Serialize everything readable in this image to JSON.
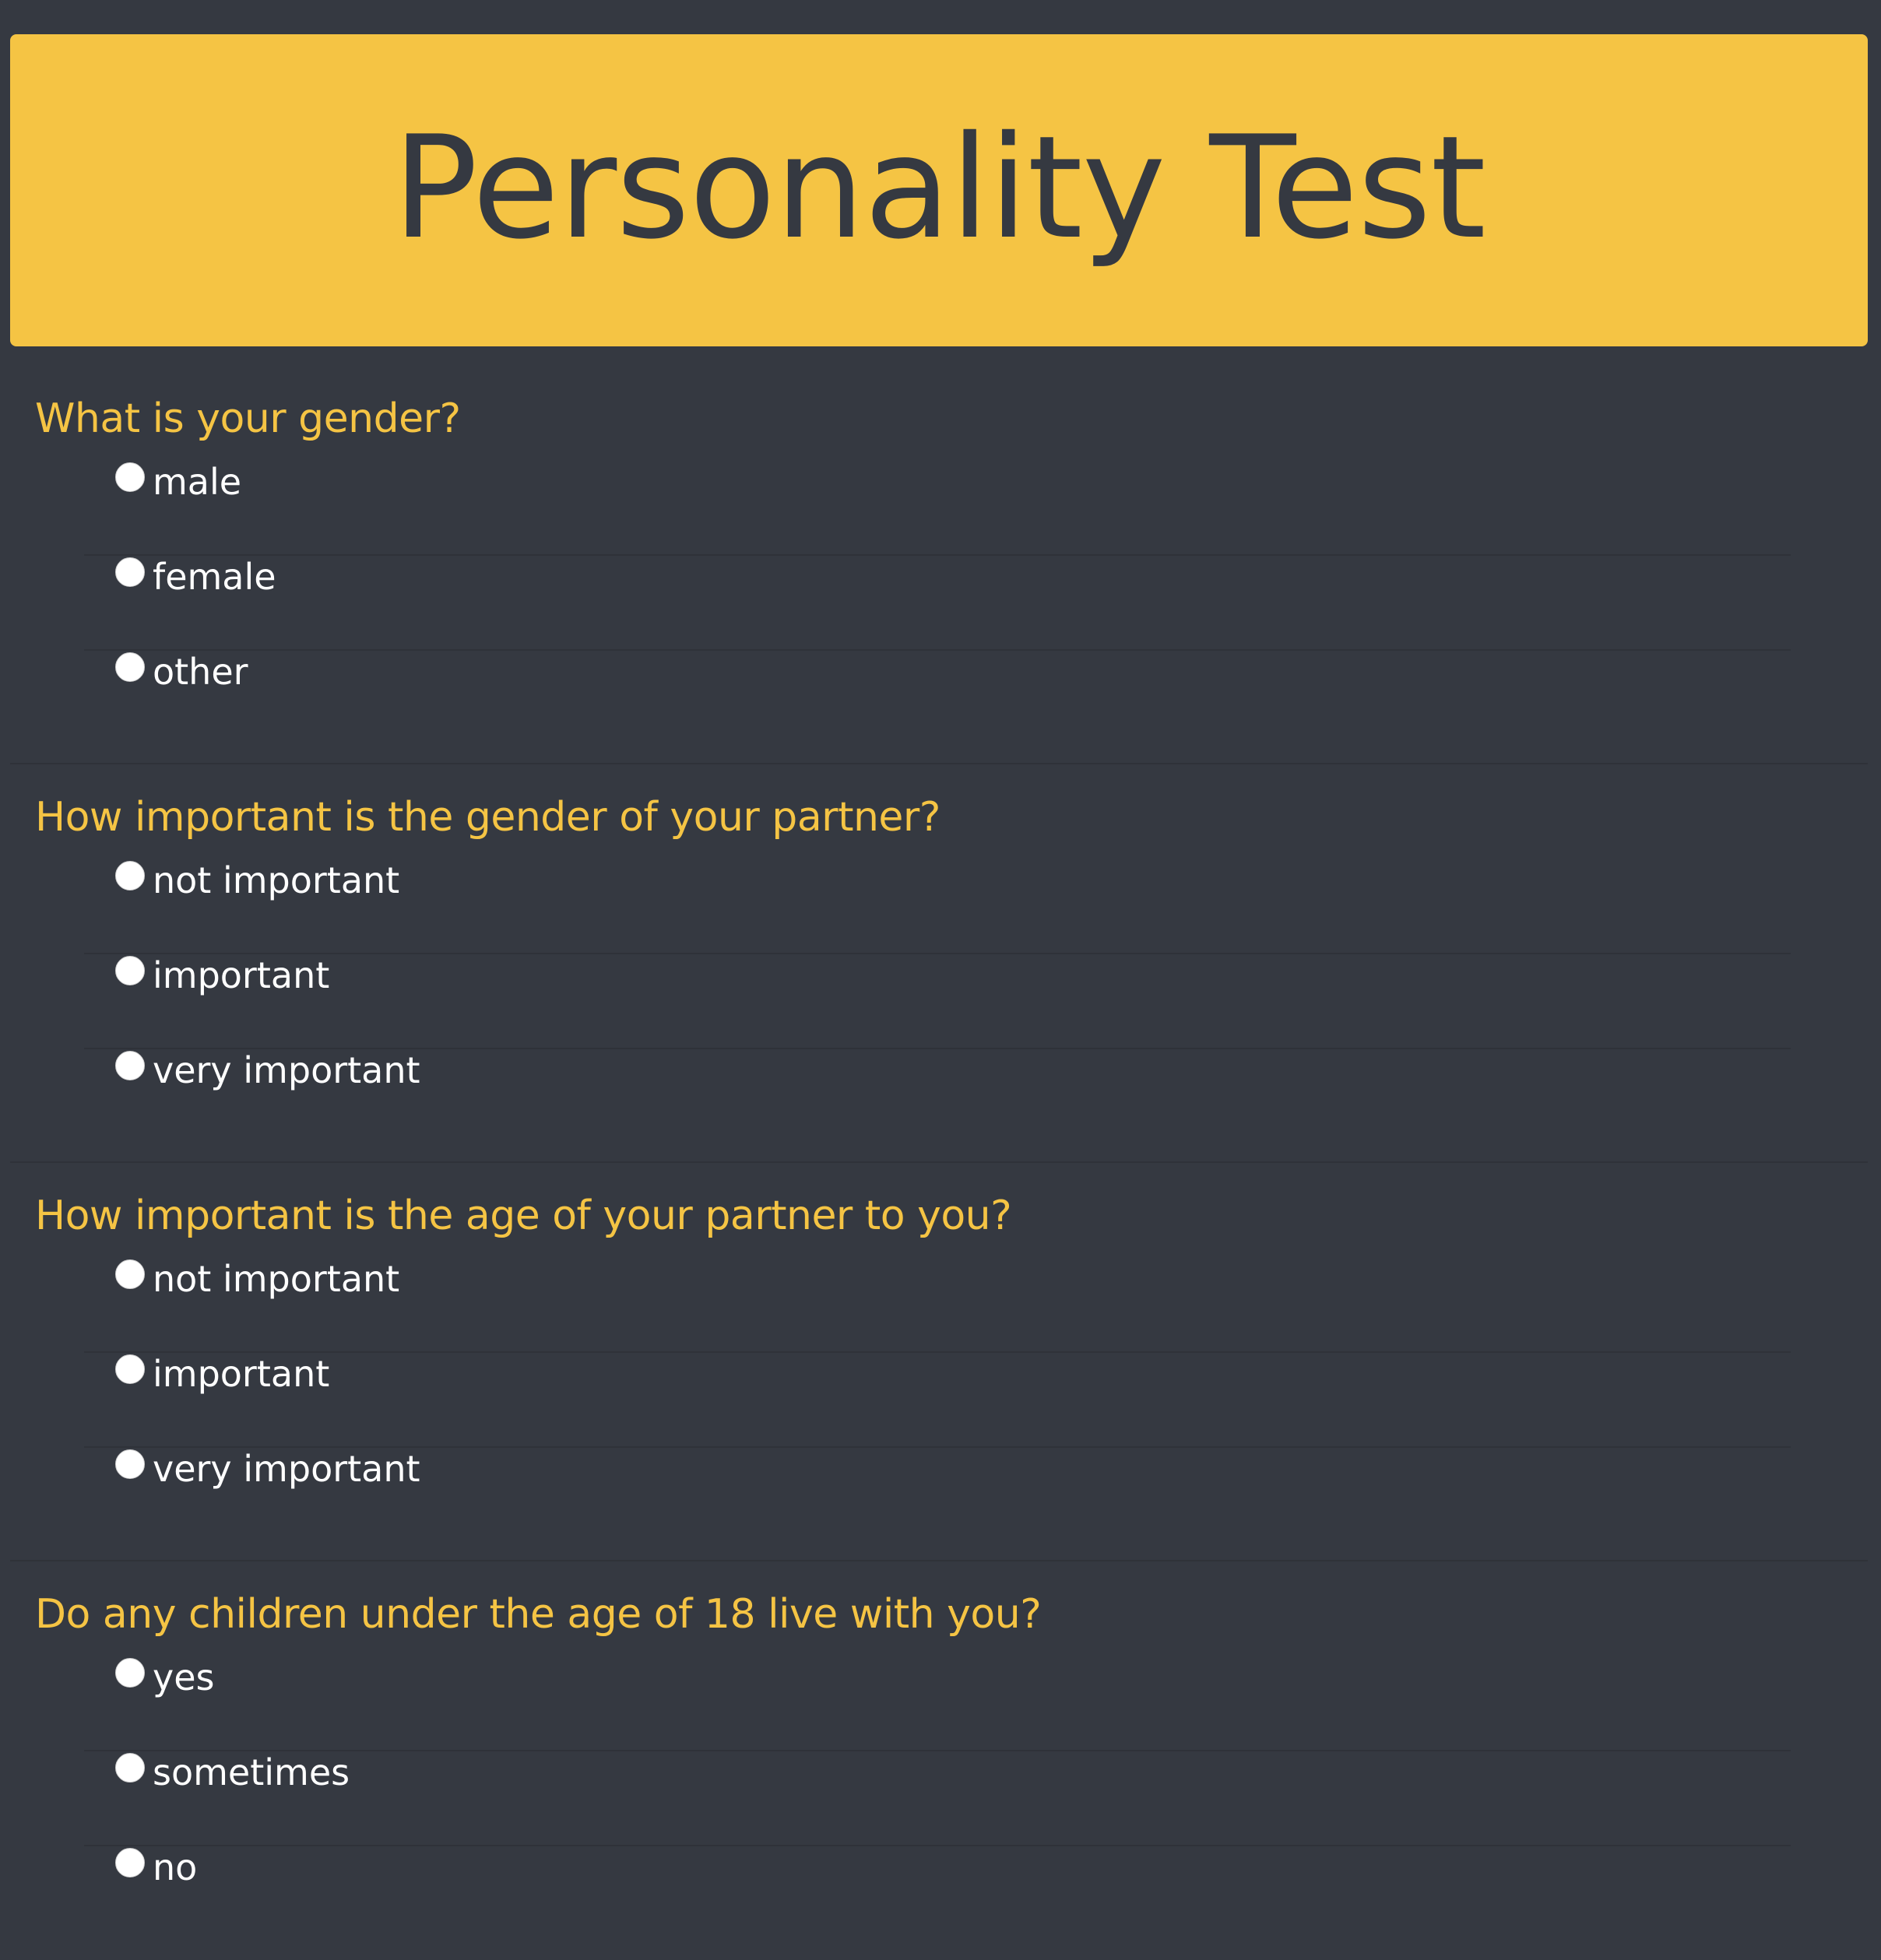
{
  "header": {
    "title": "Personality Test"
  },
  "colors": {
    "background": "#353941",
    "accent": "#f5c444",
    "option_text": "#ffffff"
  },
  "questions": [
    {
      "title": "What is your gender?",
      "options": [
        "male",
        "female",
        "other"
      ]
    },
    {
      "title": "How important is the gender of your partner?",
      "options": [
        "not important",
        "important",
        "very important"
      ]
    },
    {
      "title": "How important is the age of your partner to you?",
      "options": [
        "not important",
        "important",
        "very important"
      ]
    },
    {
      "title": "Do any children under the age of 18 live with you?",
      "options": [
        "yes",
        "sometimes",
        "no"
      ]
    }
  ]
}
